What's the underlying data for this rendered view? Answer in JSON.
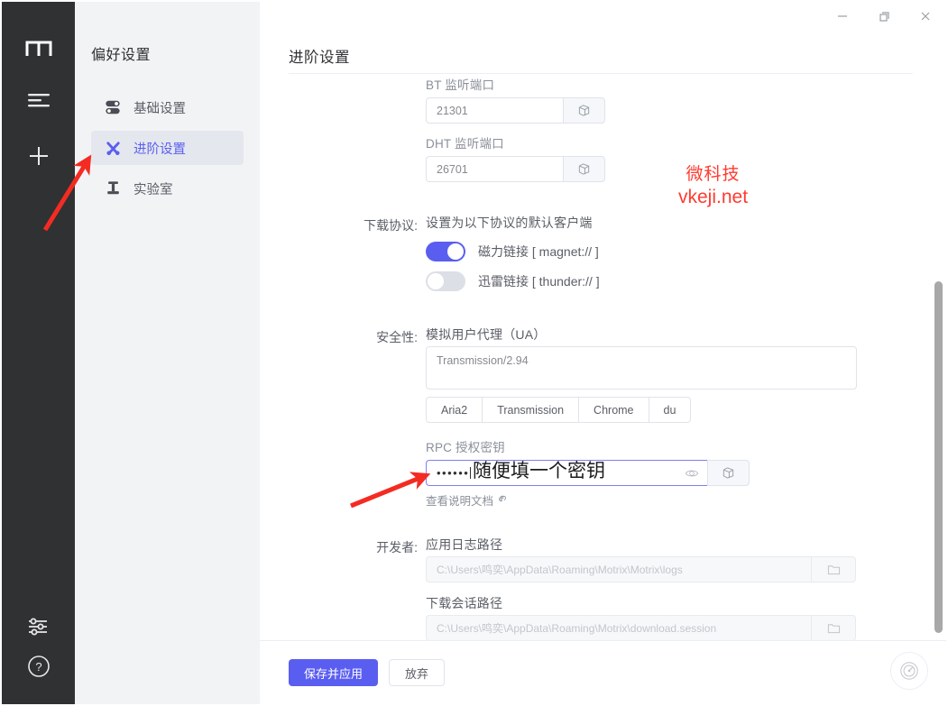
{
  "window": {
    "controls": [
      {
        "name": "minimize",
        "glyph": "–"
      },
      {
        "name": "maximize",
        "glyph": "❐"
      },
      {
        "name": "close",
        "glyph": "✕"
      }
    ]
  },
  "rail": {
    "logo": "m",
    "items": [
      {
        "name": "menu-icon",
        "label": "菜单"
      },
      {
        "name": "add-icon",
        "label": "新建任务"
      }
    ],
    "bottom": [
      {
        "name": "sliders-icon",
        "label": "速度设置"
      },
      {
        "name": "help-icon",
        "label": "帮助"
      }
    ]
  },
  "nav": {
    "title": "偏好设置",
    "items": [
      {
        "icon": "toggles-icon",
        "label": "基础设置",
        "active": false
      },
      {
        "icon": "tools-icon",
        "label": "进阶设置",
        "active": true
      },
      {
        "icon": "flask-icon",
        "label": "实验室",
        "active": false
      }
    ]
  },
  "page": {
    "title": "进阶设置"
  },
  "form": {
    "bt_port": {
      "label": "BT 监听端口",
      "value": "21301",
      "copy_icon": "copy-icon"
    },
    "dht_port": {
      "label": "DHT 监听端口",
      "value": "26701",
      "copy_icon": "copy-icon"
    },
    "protocol": {
      "row_label": "下载协议:",
      "description": "设置为以下协议的默认客户端",
      "toggles": [
        {
          "label": "磁力链接 [ magnet:// ]",
          "on": true
        },
        {
          "label": "迅雷链接 [ thunder:// ]",
          "on": false
        }
      ]
    },
    "security": {
      "row_label": "安全性:",
      "ua_label": "模拟用户代理（UA）",
      "ua_value": "Transmission/2.94",
      "ua_presets": [
        "Aria2",
        "Transmission",
        "Chrome",
        "du"
      ],
      "rpc_label": "RPC 授权密钥",
      "rpc_masked": "••••••",
      "eye_icon": "eye-icon",
      "copy_icon": "copy-icon",
      "doc_link": "查看说明文档",
      "doc_link_icon": "external-link-icon"
    },
    "developer": {
      "row_label": "开发者:",
      "log_label": "应用日志路径",
      "log_path": "C:\\Users\\鸣奕\\AppData\\Roaming\\Motrix\\Motrix\\logs",
      "session_label": "下载会话路径",
      "session_path": "C:\\Users\\鸣奕\\AppData\\Roaming\\Motrix\\download.session",
      "folder_icon": "folder-icon"
    }
  },
  "footer": {
    "save_label": "保存并应用",
    "discard_label": "放弃",
    "fab_icon": "speed-gauge-icon"
  },
  "overlays": {
    "watermark_line1": "微科技",
    "watermark_line2": "vkeji.net",
    "annotation_note": "随便填一个密钥",
    "accent": "#5a5ef0",
    "annotation_color": "#fe3b30"
  }
}
